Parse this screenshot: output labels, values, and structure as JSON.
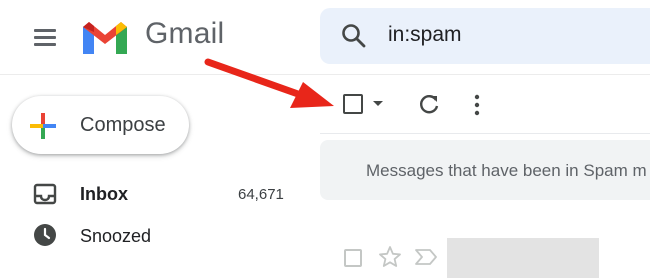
{
  "header": {
    "brand": "Gmail",
    "search": {
      "value": "in:spam"
    }
  },
  "compose": {
    "label": "Compose"
  },
  "sidebar": {
    "items": [
      {
        "label": "Inbox",
        "count": "64,671",
        "icon": "inbox-icon"
      },
      {
        "label": "Snoozed",
        "icon": "clock-icon"
      }
    ]
  },
  "banner": {
    "text": "Messages that have been in Spam m"
  },
  "colors": {
    "search_bg": "#eaf1fb",
    "annotation_arrow": "#e8261a"
  }
}
